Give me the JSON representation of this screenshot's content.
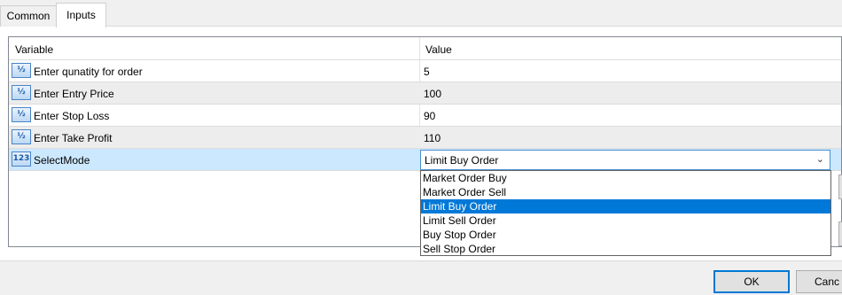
{
  "tabs": {
    "common": "Common",
    "inputs": "Inputs"
  },
  "grid": {
    "header_variable": "Variable",
    "header_value": "Value",
    "rows": [
      {
        "icon": "½",
        "name": "Enter qunatity for order",
        "value": "5"
      },
      {
        "icon": "½",
        "name": "Enter Entry Price",
        "value": "100"
      },
      {
        "icon": "½",
        "name": "Enter Stop Loss",
        "value": "90"
      },
      {
        "icon": "½",
        "name": "Enter Take Profit",
        "value": "110"
      },
      {
        "icon": "123",
        "name": "SelectMode",
        "value": "Limit Buy Order"
      }
    ]
  },
  "dropdown": {
    "options": [
      "Market Order Buy",
      "Market Order Sell",
      "Limit Buy Order",
      "Limit Sell Order",
      "Buy Stop Order",
      "Sell Stop Order"
    ],
    "selected_index": 2
  },
  "footer": {
    "ok_label": "OK",
    "cancel_label": "Canc"
  },
  "icons": {
    "fraction": "fraction-type-icon",
    "integer": "integer-type-icon",
    "chevron": "chevron-down-icon"
  },
  "colors": {
    "selection": "#cce8ff",
    "highlight": "#0078d7",
    "focus_border": "#4d90d0"
  }
}
